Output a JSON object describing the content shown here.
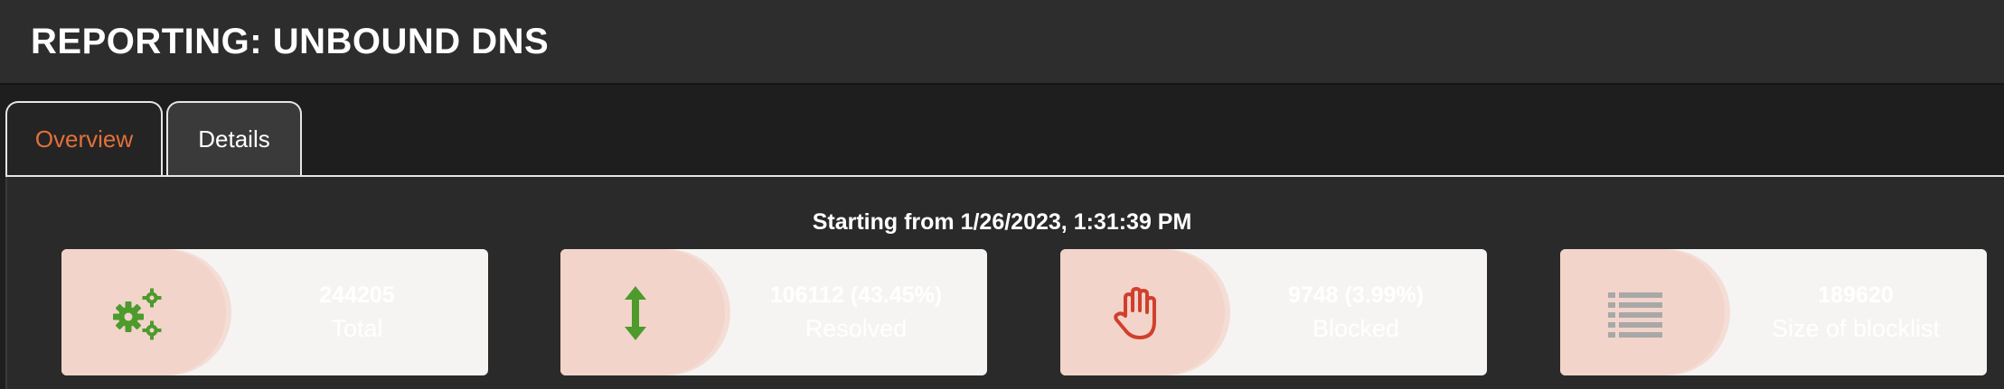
{
  "header": {
    "title": "REPORTING: UNBOUND DNS"
  },
  "tabs": [
    {
      "label": "Overview",
      "active": true
    },
    {
      "label": "Details",
      "active": false
    }
  ],
  "subtitle": "Starting from 1/26/2023, 1:31:39 PM",
  "cards": [
    {
      "value": "244205",
      "label": "Total",
      "icon": "gears-icon",
      "icon_color": "#4d9a2d"
    },
    {
      "value": "106112 (43.45%)",
      "label": "Resolved",
      "icon": "up-down-arrow-icon",
      "icon_color": "#4d9a2d"
    },
    {
      "value": "9748 (3.99%)",
      "label": "Blocked",
      "icon": "hand-stop-icon",
      "icon_color": "#d0402c"
    },
    {
      "value": "189620",
      "label": "Size of blocklist",
      "icon": "list-icon",
      "icon_color": "#a8a8a8"
    }
  ],
  "colors": {
    "accent": "#e2703a",
    "background": "#1e1e1e",
    "header": "#2d2d2d",
    "card_bg": "#f6f4f3",
    "card_icon_bg": "#f2d4ca"
  }
}
